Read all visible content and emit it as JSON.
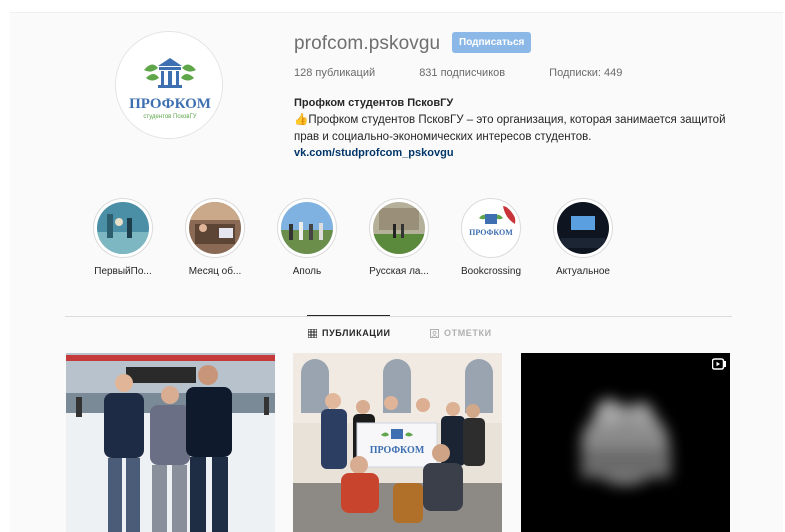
{
  "profile": {
    "username": "profcom.pskovgu",
    "follow_label": "Подписаться",
    "stats": {
      "posts": "128 публикаций",
      "followers": "831 подписчиков",
      "following": "Подписки: 449"
    },
    "full_name": "Профком студентов ПсковГУ",
    "bio_hand": "👍",
    "bio_text": "Профком студентов ПсковГУ – это организация, которая занимается защитой прав и социально-экономических интересов студентов.",
    "link": "vk.com/studprofcom_pskovgu",
    "logo_text": "ПРОФКОМ",
    "logo_subtext": "студентов ПсковГУ"
  },
  "highlights": [
    {
      "label": "ПервыйПо..."
    },
    {
      "label": "Месяц об..."
    },
    {
      "label": "Аполь"
    },
    {
      "label": "Русская ла..."
    },
    {
      "label": "Bookcrossing"
    },
    {
      "label": "Актуальное"
    }
  ],
  "tabs": {
    "posts": "ПУБЛИКАЦИИ",
    "tagged": "ОТМЕТКИ"
  },
  "posts": {
    "banner_text": "ПРОФКОМ"
  },
  "colors": {
    "follow_button": "#8cb8e8",
    "link": "#003569",
    "logo_blue": "#3e6fb0",
    "logo_green": "#5fa54a"
  }
}
